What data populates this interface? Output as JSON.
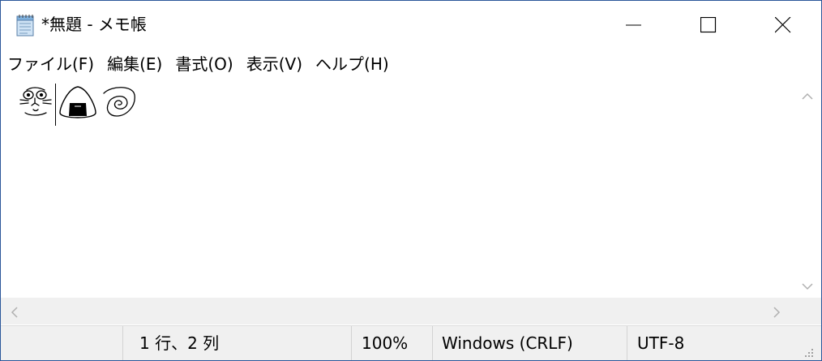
{
  "window": {
    "title": "*無題 - メモ帳",
    "app_icon": "notepad-icon"
  },
  "title_buttons": {
    "minimize_icon": "minimize-icon",
    "maximize_icon": "maximize-icon",
    "close_icon": "close-icon"
  },
  "menu": {
    "items": [
      {
        "label": "ファイル(F)"
      },
      {
        "label": "編集(E)"
      },
      {
        "label": "書式(O)"
      },
      {
        "label": "表示(V)"
      },
      {
        "label": "ヘルプ(H)"
      }
    ]
  },
  "editor": {
    "content_glyphs": [
      "cat-face-doodle",
      "onigiri-doodle",
      "spiral-doodle"
    ]
  },
  "status": {
    "position": "1 行、2 列",
    "zoom": "100%",
    "line_ending": "Windows (CRLF)",
    "encoding": "UTF-8"
  },
  "colors": {
    "window_border": "#2b579a",
    "status_bg": "#f0f0f0",
    "editor_bg": "#ffffff"
  }
}
